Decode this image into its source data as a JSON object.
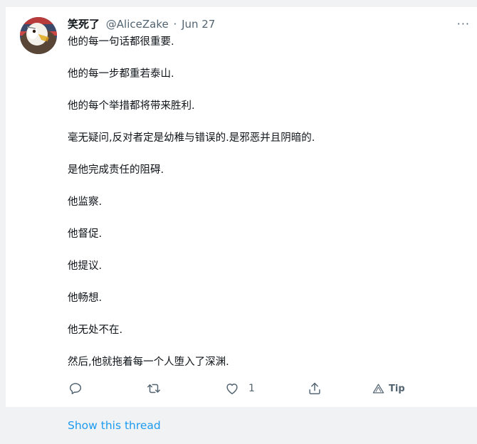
{
  "tweet": {
    "author_name": "笑死了",
    "handle": "@AliceZake",
    "separator": "·",
    "date": "Jun 27",
    "more_label": "···",
    "lines": [
      "他的每一句话都很重要.",
      "他的每一步都重若泰山.",
      "他的每个举措都将带来胜利.",
      "毫无疑问,反对者定是幼稚与错误的.是邪恶并且阴暗的.",
      "是他完成责任的阻碍.",
      "他监察.",
      "他督促.",
      "他提议.",
      "他畅想.",
      "他无处不在.",
      "然后,他就拖着每一个人堕入了深渊."
    ]
  },
  "actions": {
    "reply_icon": "reply-icon",
    "retweet_icon": "retweet-icon",
    "like_icon": "heart-icon",
    "like_count": "1",
    "share_icon": "share-icon",
    "tip_icon": "tip-icon",
    "tip_label": "Tip"
  },
  "footer": {
    "show_thread": "Show this thread"
  },
  "colors": {
    "link": "#1d9bf0",
    "muted": "#536471",
    "text": "#0f1419",
    "background": "#f0f2f4"
  }
}
